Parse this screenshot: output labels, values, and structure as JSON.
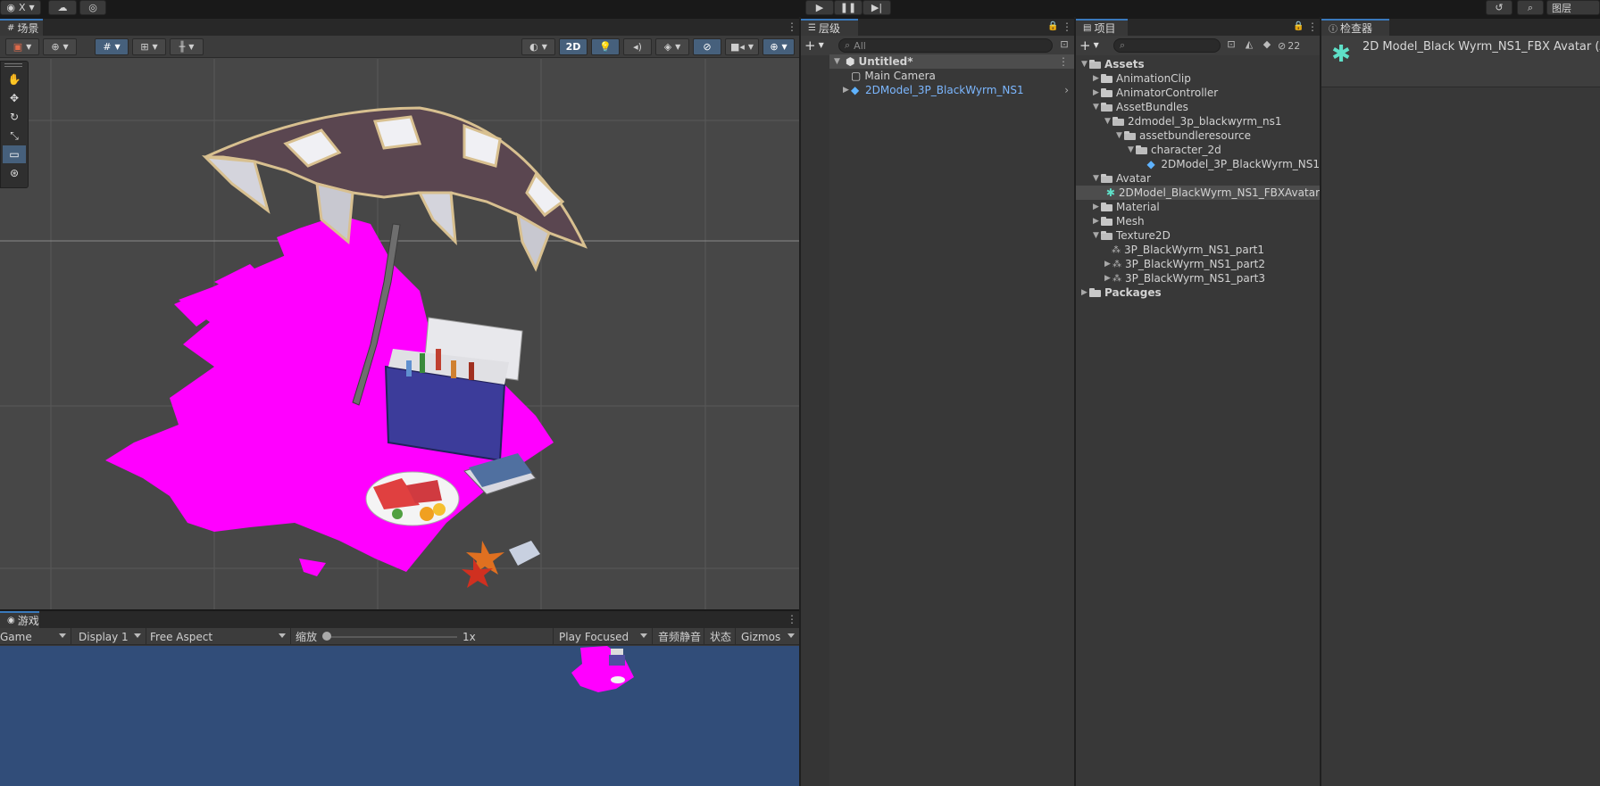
{
  "topbar": {
    "account_label": "X",
    "play_icon": "play-icon",
    "pause_icon": "pause-icon",
    "step_icon": "step-icon",
    "layers_label": "图层"
  },
  "scene": {
    "tab_label": "场景",
    "toolbar": {
      "mode_2d": "2D"
    },
    "tools": [
      "hand-icon",
      "move-icon",
      "rotate-icon",
      "scale-icon",
      "rect-tool-icon",
      "transform-icon"
    ]
  },
  "game": {
    "tab_label": "游戏",
    "view_select": "Game",
    "display_select": "Display 1",
    "aspect_select": "Free Aspect",
    "scale_label": "缩放",
    "scale_value": "1x",
    "play_mode": "Play Focused",
    "mute_label": "音频静音",
    "stats_label": "状态",
    "gizmos_label": "Gizmos"
  },
  "hierarchy": {
    "tab_label": "层级",
    "search_placeholder": "All",
    "scene_name": "Untitled*",
    "items": [
      {
        "label": "Main Camera"
      },
      {
        "label": "2DModel_3P_BlackWyrm_NS1"
      }
    ]
  },
  "project": {
    "tab_label": "项目",
    "hidden_count": "22",
    "tree": [
      {
        "label": "Assets"
      },
      {
        "label": "AnimationClip"
      },
      {
        "label": "AnimatorController"
      },
      {
        "label": "AssetBundles"
      },
      {
        "label": "2dmodel_3p_blackwyrm_ns1"
      },
      {
        "label": "assetbundleresource"
      },
      {
        "label": "character_2d"
      },
      {
        "label": "2DModel_3P_BlackWyrm_NS1"
      },
      {
        "label": "Avatar"
      },
      {
        "label": "2DModel_BlackWyrm_NS1_FBXAvatar"
      },
      {
        "label": "Material"
      },
      {
        "label": "Mesh"
      },
      {
        "label": "Texture2D"
      },
      {
        "label": "3P_BlackWyrm_NS1_part1"
      },
      {
        "label": "3P_BlackWyrm_NS1_part2"
      },
      {
        "label": "3P_BlackWyrm_NS1_part3"
      },
      {
        "label": "Packages"
      }
    ]
  },
  "inspector": {
    "tab_label": "检查器",
    "title": "2D Model_Black Wyrm_NS1_FBX Avatar (Av"
  }
}
